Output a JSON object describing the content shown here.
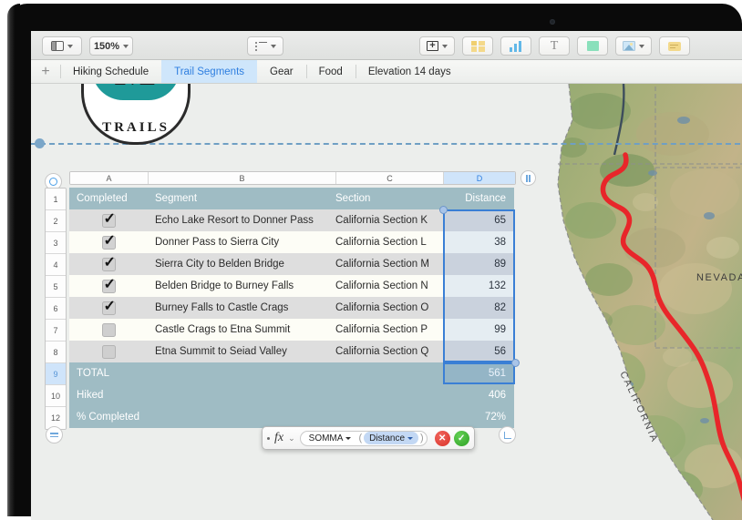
{
  "app": {
    "toolbar": {
      "view_label": "View",
      "zoom_level": "150%",
      "view_icon": "sidebar-icon",
      "zoom_chevron_icon": "chevron-down-icon",
      "list_icon": "bulleted-list-icon",
      "right_buttons": [
        {
          "name": "insert-table-button",
          "icon": "table-plus-icon",
          "label": ""
        },
        {
          "name": "table-button",
          "icon": "table-grid-icon",
          "label": ""
        },
        {
          "name": "chart-button",
          "icon": "bar-chart-icon",
          "label": ""
        },
        {
          "name": "text-button",
          "icon": "text-t-icon",
          "label": "T"
        },
        {
          "name": "shape-button",
          "icon": "shape-square-icon",
          "label": ""
        },
        {
          "name": "media-button",
          "icon": "photo-icon",
          "label": ""
        },
        {
          "name": "comment-button",
          "icon": "comment-icon",
          "label": ""
        }
      ]
    },
    "tabs": {
      "add_label": "+",
      "items": [
        {
          "label": "Hiking Schedule",
          "active": false
        },
        {
          "label": "Trail Segments",
          "active": true
        },
        {
          "label": "Gear",
          "active": false
        },
        {
          "label": "Food",
          "active": false
        },
        {
          "label": "Elevation 14 days",
          "active": false
        }
      ]
    },
    "logo": {
      "monogram": "M",
      "wordmark": "TRAILS"
    },
    "map": {
      "state_label": "CALIFORNIA",
      "neighbor_label": "NEVADA",
      "route_color": "#e8262a",
      "route_name": "pacific-crest-trail-route"
    },
    "table": {
      "column_headers": [
        "A",
        "B",
        "C",
        "D"
      ],
      "selected_column": "D",
      "row_numbers": [
        "1",
        "2",
        "3",
        "4",
        "5",
        "6",
        "7",
        "8",
        "9",
        "10",
        "12"
      ],
      "selected_row": "9",
      "header": {
        "completed": "Completed",
        "segment": "Segment",
        "section": "Section",
        "distance": "Distance"
      },
      "rows": [
        {
          "completed": true,
          "segment": "Echo Lake Resort to Donner Pass",
          "section": "California Section K",
          "distance": "65"
        },
        {
          "completed": true,
          "segment": "Donner Pass to Sierra City",
          "section": "California Section L",
          "distance": "38"
        },
        {
          "completed": true,
          "segment": "Sierra City to Belden Bridge",
          "section": "California Section M",
          "distance": "89"
        },
        {
          "completed": true,
          "segment": "Belden Bridge to Burney Falls",
          "section": "California Section N",
          "distance": "132"
        },
        {
          "completed": true,
          "segment": "Burney Falls to Castle Crags",
          "section": "California Section O",
          "distance": "82"
        },
        {
          "completed": false,
          "segment": "Castle Crags to Etna Summit",
          "section": "California Section P",
          "distance": "99"
        },
        {
          "completed": false,
          "segment": "Etna Summit to Seiad Valley",
          "section": "California Section Q",
          "distance": "56"
        }
      ],
      "footer_rows": [
        {
          "label": "TOTAL",
          "value": "561"
        },
        {
          "label": "Hiked",
          "value": "406"
        },
        {
          "label": "% Completed",
          "value": "72%"
        }
      ],
      "header_color": "#9fbcc4",
      "selection_color": "#3a7fd5"
    },
    "formula_editor": {
      "fx_label": "fx",
      "function_name": "SOMMA",
      "argument": "Distance",
      "cancel_label": "✕",
      "accept_label": "✓",
      "cancel_name": "cancel-formula-button",
      "accept_name": "accept-formula-button"
    }
  }
}
